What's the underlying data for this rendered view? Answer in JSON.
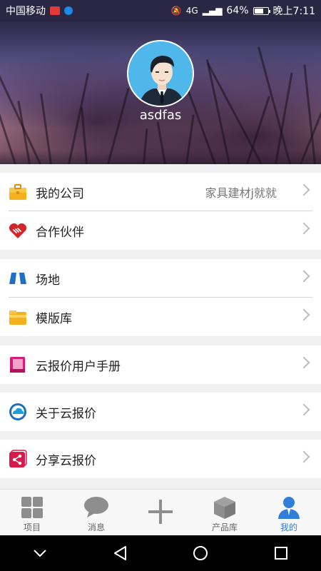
{
  "status_bar": {
    "carrier": "中国移动",
    "network": "4G",
    "battery": "64%",
    "battery_level": 0.64,
    "time": "晚上7:11"
  },
  "profile": {
    "username": "asdfas"
  },
  "menu": {
    "company": {
      "label": "我的公司",
      "value": "家具建材j就就",
      "icon": "briefcase-icon"
    },
    "partners": {
      "label": "合作伙伴",
      "icon": "handshake-heart-icon"
    },
    "venue": {
      "label": "场地",
      "icon": "road-icon"
    },
    "templates": {
      "label": "模版库",
      "icon": "folder-icon"
    },
    "manual": {
      "label": "云报价用户手册",
      "icon": "book-icon"
    },
    "about": {
      "label": "关于云报价",
      "icon": "cloud-logo-icon"
    },
    "share": {
      "label": "分享云报价",
      "icon": "share-icon"
    }
  },
  "bottom_nav": {
    "items": [
      {
        "label": "项目",
        "icon": "grid-icon"
      },
      {
        "label": "消息",
        "icon": "chat-bubble-icon"
      },
      {
        "label": "",
        "icon": "plus-icon"
      },
      {
        "label": "产品库",
        "icon": "box-icon"
      },
      {
        "label": "我的",
        "icon": "user-icon",
        "active": true
      }
    ]
  },
  "colors": {
    "accent": "#2f7ed8",
    "avatar_bg": "#4fb7ea"
  }
}
